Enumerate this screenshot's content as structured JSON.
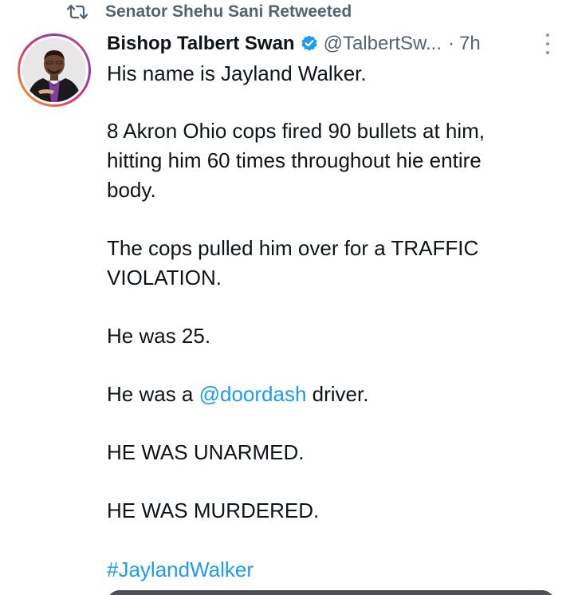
{
  "retweet": {
    "label": "Senator Shehu Sani Retweeted",
    "icon": "retweet-icon"
  },
  "author": {
    "name": "Bishop Talbert Swan",
    "verified_icon": "verified-badge-icon",
    "handle": "@TalbertSw...",
    "separator": "·",
    "time": "7h"
  },
  "tweet": {
    "line1": "His name is Jayland Walker.",
    "line2": "8 Akron Ohio cops fired 90 bullets at him,",
    "line3": "hitting him 60 times throughout hie entire",
    "line4": "body.",
    "line5": "The cops pulled him over for a TRAFFIC",
    "line6": "VIOLATION.",
    "line7": "He was 25.",
    "line8_pre": "He was a ",
    "line8_mention": "@doordash",
    "line8_post": " driver.",
    "line9": "HE WAS UNARMED.",
    "line10": "HE WAS MURDERED.",
    "hashtag": "#JaylandWalker"
  },
  "colors": {
    "text": "#0f1419",
    "secondary": "#536471",
    "link": "#1d9bf0",
    "verified": "#1d9bf0"
  }
}
